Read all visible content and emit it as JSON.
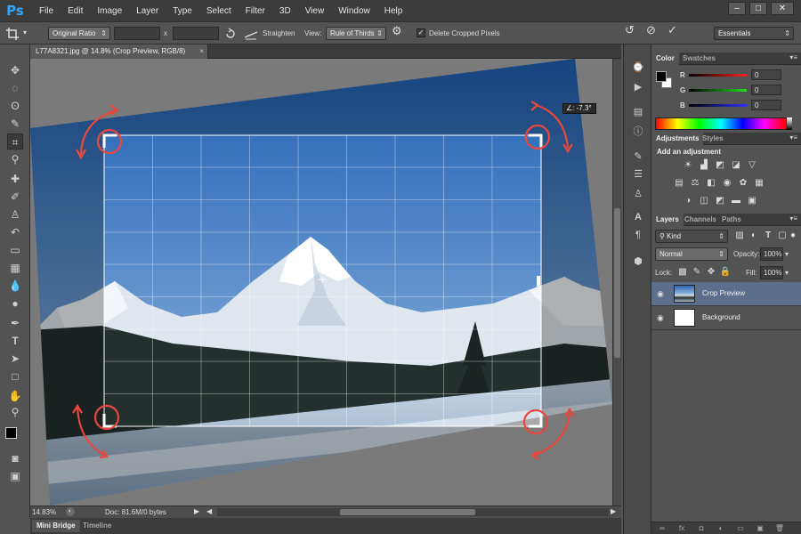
{
  "app": {
    "logo": "Ps",
    "menus": [
      "File",
      "Edit",
      "Image",
      "Layer",
      "Type",
      "Select",
      "Filter",
      "3D",
      "View",
      "Window",
      "Help"
    ],
    "window_controls": [
      "–",
      "□",
      "✕"
    ]
  },
  "options": {
    "ratio": "Original Ratio",
    "width_value": "",
    "x_label": "x",
    "height_value": "",
    "straighten_label": "Straighten",
    "view_label": "View:",
    "view_value": "Rule of Thirds",
    "delete_cropped_label": "Delete Cropped Pixels",
    "delete_cropped_checked": true,
    "workspace": "Essentials"
  },
  "document": {
    "tab_title": "L77A8321.jpg @ 14.8% (Crop Preview, RGB/8)",
    "rotation_readout": "-7.3°",
    "zoom": "14.83%",
    "doc_info": "Doc: 81.6M/0 bytes"
  },
  "bottom_tabs": [
    "Mini Bridge",
    "Timeline"
  ],
  "color_panel": {
    "tabs": [
      "Color",
      "Swatches"
    ],
    "channels": [
      {
        "label": "R",
        "value": "0",
        "color": "#ff2020"
      },
      {
        "label": "G",
        "value": "0",
        "color": "#20e020"
      },
      {
        "label": "B",
        "value": "0",
        "color": "#3030ff"
      }
    ]
  },
  "adjustments_panel": {
    "tabs": [
      "Adjustments",
      "Styles"
    ],
    "heading": "Add an adjustment"
  },
  "layers_panel": {
    "tabs": [
      "Layers",
      "Channels",
      "Paths"
    ],
    "kind_label": "Kind",
    "blend_mode": "Normal",
    "opacity_label": "Opacity:",
    "opacity_value": "100%",
    "lock_label": "Lock:",
    "fill_label": "Fill:",
    "fill_value": "100%",
    "layers": [
      {
        "name": "Crop Preview",
        "selected": true
      },
      {
        "name": "Background",
        "selected": false
      }
    ]
  },
  "colors": {
    "accent": "#31a8ff",
    "annotation_red": "#e8473c",
    "selected_layer": "#5b6f8c"
  }
}
